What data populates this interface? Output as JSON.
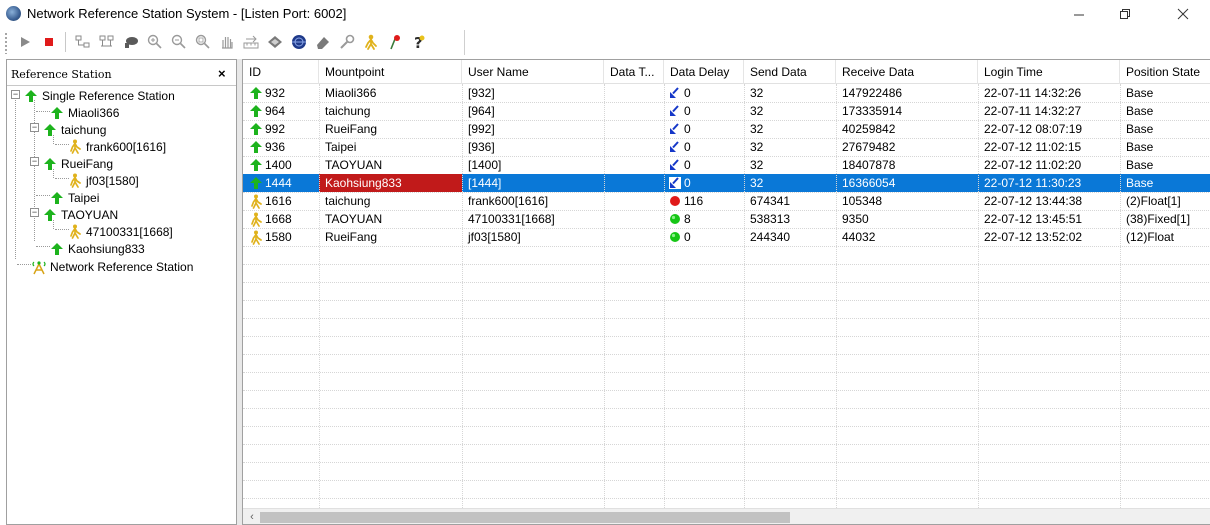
{
  "window": {
    "title": "Network Reference Station System - [Listen Port: 6002]",
    "controls": {
      "minimize": "–",
      "maximize": "❐",
      "close": "✕"
    }
  },
  "toolbar": {
    "buttons": [
      {
        "icon": "play-icon"
      },
      {
        "icon": "stop-icon"
      },
      {
        "icon": "network-add-icon"
      },
      {
        "icon": "network-config-icon"
      },
      {
        "icon": "connect-icon"
      },
      {
        "icon": "zoom-in-icon"
      },
      {
        "icon": "zoom-out-icon"
      },
      {
        "icon": "zoom-fit-icon"
      },
      {
        "icon": "pan-hand-icon"
      },
      {
        "icon": "distance-icon"
      },
      {
        "icon": "layer-icon"
      },
      {
        "icon": "globe-icon"
      },
      {
        "icon": "eraser-icon"
      },
      {
        "icon": "wrench-icon"
      },
      {
        "icon": "user-icon"
      },
      {
        "icon": "marker-icon"
      },
      {
        "icon": "help-icon"
      }
    ]
  },
  "colors": {
    "station_green": "#1db31d",
    "rover_yellow": "#e0b21c",
    "delay_arrow": "#1537c8",
    "status_red": "#e01a1a",
    "status_green": "#16c616",
    "selected_row": "#0a78d7",
    "selected_mount": "#c11a1a"
  },
  "tree": {
    "header": "Reference Station",
    "close": "×",
    "nodes": [
      {
        "label": "Single Reference Station",
        "icon": "station-icon"
      },
      {
        "label": "Miaoli366",
        "icon": "station-icon"
      },
      {
        "label": "taichung",
        "icon": "station-icon"
      },
      {
        "label": "frank600[1616]",
        "icon": "rover-icon"
      },
      {
        "label": "RueiFang",
        "icon": "station-icon"
      },
      {
        "label": "jf03[1580]",
        "icon": "rover-icon"
      },
      {
        "label": "Taipei",
        "icon": "station-icon"
      },
      {
        "label": "TAOYUAN",
        "icon": "station-icon"
      },
      {
        "label": "47100331[1668]",
        "icon": "rover-icon"
      },
      {
        "label": "Kaohsiung833",
        "icon": "station-icon"
      },
      {
        "label": "Network Reference Station",
        "icon": "network-station-icon"
      }
    ]
  },
  "table": {
    "columns": [
      "ID",
      "Mountpoint",
      "User Name",
      "Data T...",
      "Data Delay",
      "Send Data",
      "Receive Data",
      "Login Time",
      "Position State"
    ],
    "rows": [
      {
        "kind": "station",
        "id": "932",
        "mountpoint": "Miaoli366",
        "user": "[932]",
        "data_type": "",
        "delay_icon": "down-arrow",
        "delay": "0",
        "send": "32",
        "receive": "147922486",
        "login": "22-07-11 14:32:26",
        "state": "Base",
        "selected": false
      },
      {
        "kind": "station",
        "id": "964",
        "mountpoint": "taichung",
        "user": "[964]",
        "data_type": "",
        "delay_icon": "down-arrow",
        "delay": "0",
        "send": "32",
        "receive": "173335914",
        "login": "22-07-11 14:32:27",
        "state": "Base",
        "selected": false
      },
      {
        "kind": "station",
        "id": "992",
        "mountpoint": "RueiFang",
        "user": "[992]",
        "data_type": "",
        "delay_icon": "down-arrow",
        "delay": "0",
        "send": "32",
        "receive": "40259842",
        "login": "22-07-12 08:07:19",
        "state": "Base",
        "selected": false
      },
      {
        "kind": "station",
        "id": "936",
        "mountpoint": "Taipei",
        "user": "[936]",
        "data_type": "",
        "delay_icon": "down-arrow",
        "delay": "0",
        "send": "32",
        "receive": "27679482",
        "login": "22-07-12 11:02:15",
        "state": "Base",
        "selected": false
      },
      {
        "kind": "station",
        "id": "1400",
        "mountpoint": "TAOYUAN",
        "user": "[1400]",
        "data_type": "",
        "delay_icon": "down-arrow",
        "delay": "0",
        "send": "32",
        "receive": "18407878",
        "login": "22-07-12 11:02:20",
        "state": "Base",
        "selected": false
      },
      {
        "kind": "station",
        "id": "1444",
        "mountpoint": "Kaohsiung833",
        "user": "[1444]",
        "data_type": "",
        "delay_icon": "down-arrow",
        "delay": "0",
        "send": "32",
        "receive": "16366054",
        "login": "22-07-12 11:30:23",
        "state": "Base",
        "selected": true
      },
      {
        "kind": "rover",
        "id": "1616",
        "mountpoint": "taichung",
        "user": "frank600[1616]",
        "data_type": "",
        "delay_icon": "red-dot",
        "delay": "116",
        "send": "674341",
        "receive": "105348",
        "login": "22-07-12 13:44:38",
        "state": "(2)Float[1]",
        "selected": false
      },
      {
        "kind": "rover",
        "id": "1668",
        "mountpoint": "TAOYUAN",
        "user": "47100331[1668]",
        "data_type": "",
        "delay_icon": "green-dot",
        "delay": "8",
        "send": "538313",
        "receive": "9350",
        "login": "22-07-12 13:45:51",
        "state": "(38)Fixed[1]",
        "selected": false
      },
      {
        "kind": "rover",
        "id": "1580",
        "mountpoint": "RueiFang",
        "user": "jf03[1580]",
        "data_type": "",
        "delay_icon": "green-dot",
        "delay": "0",
        "send": "244340",
        "receive": "44032",
        "login": "22-07-12 13:52:02",
        "state": "(12)Float",
        "selected": false
      }
    ]
  },
  "scrollbar": {
    "left_arrow": "‹"
  }
}
